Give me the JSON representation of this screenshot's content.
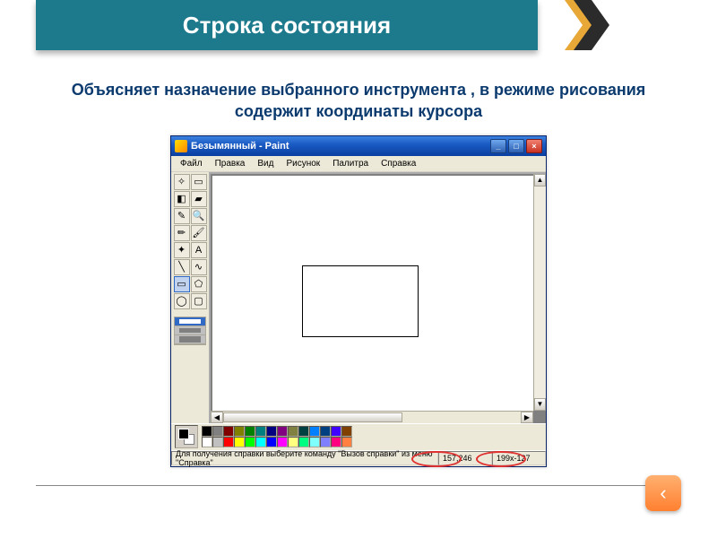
{
  "slide": {
    "title": "Строка состояния",
    "description": "Объясняет назначение выбранного инструмента , в режиме рисования содержит координаты курсора"
  },
  "paint": {
    "title": "Безымянный - Paint",
    "menu": [
      "Файл",
      "Правка",
      "Вид",
      "Рисунок",
      "Палитра",
      "Справка"
    ],
    "tools": [
      {
        "name": "free-select",
        "glyph": "✧"
      },
      {
        "name": "rect-select",
        "glyph": "▭"
      },
      {
        "name": "eraser",
        "glyph": "◧"
      },
      {
        "name": "fill",
        "glyph": "▰"
      },
      {
        "name": "picker",
        "glyph": "✎"
      },
      {
        "name": "magnifier",
        "glyph": "🔍"
      },
      {
        "name": "pencil",
        "glyph": "✏"
      },
      {
        "name": "brush",
        "glyph": "🖌"
      },
      {
        "name": "airbrush",
        "glyph": "✦"
      },
      {
        "name": "text",
        "glyph": "A"
      },
      {
        "name": "line",
        "glyph": "╲"
      },
      {
        "name": "curve",
        "glyph": "∿"
      },
      {
        "name": "rectangle",
        "glyph": "▭"
      },
      {
        "name": "polygon",
        "glyph": "⬠"
      },
      {
        "name": "ellipse",
        "glyph": "◯"
      },
      {
        "name": "round-rect",
        "glyph": "▢"
      }
    ],
    "palette_row1": [
      "#000",
      "#808080",
      "#800000",
      "#808000",
      "#008000",
      "#008080",
      "#000080",
      "#800080",
      "#808040",
      "#004040",
      "#0080ff",
      "#004080",
      "#4000ff",
      "#804000"
    ],
    "palette_row2": [
      "#fff",
      "#c0c0c0",
      "#ff0000",
      "#ffff00",
      "#00ff00",
      "#00ffff",
      "#0000ff",
      "#ff00ff",
      "#ffff80",
      "#00ff80",
      "#80ffff",
      "#8080ff",
      "#ff0080",
      "#ff8040"
    ],
    "status": {
      "hint": "Для получения справки выберите команду \"Вызов справки\" из меню \"Справка\"",
      "coords": "157,246",
      "size": "199x-127"
    }
  },
  "nav": {
    "back_glyph": "‹"
  }
}
